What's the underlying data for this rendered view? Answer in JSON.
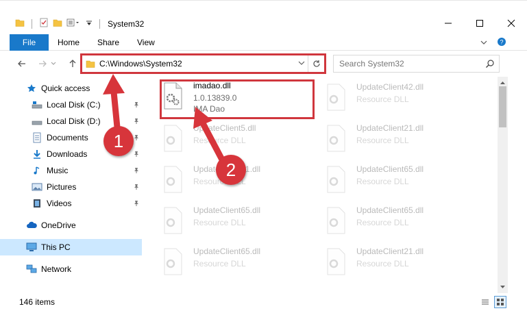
{
  "window": {
    "title": "System32",
    "controls": [
      "minimize-icon",
      "maximize-icon",
      "close-icon"
    ]
  },
  "ribbon": {
    "file_label": "File",
    "tabs": [
      "Home",
      "Share",
      "View"
    ]
  },
  "address_bar": {
    "path": "C:\\Windows\\System32"
  },
  "search": {
    "placeholder": "Search System32"
  },
  "sidebar": {
    "items": [
      {
        "label": "Quick access",
        "icon": "star-icon",
        "pinned": false
      },
      {
        "label": "Local Disk (C:)",
        "icon": "drive-icon",
        "pinned": true
      },
      {
        "label": "Local Disk (D:)",
        "icon": "drive-icon",
        "pinned": true
      },
      {
        "label": "Documents",
        "icon": "documents-icon",
        "pinned": true
      },
      {
        "label": "Downloads",
        "icon": "downloads-icon",
        "pinned": true
      },
      {
        "label": "Music",
        "icon": "music-icon",
        "pinned": true
      },
      {
        "label": "Pictures",
        "icon": "pictures-icon",
        "pinned": true
      },
      {
        "label": "Videos",
        "icon": "videos-icon",
        "pinned": true
      },
      {
        "label": "OneDrive",
        "icon": "onedrive-icon",
        "pinned": false
      },
      {
        "label": "This PC",
        "icon": "pc-icon",
        "pinned": false,
        "selected": true
      },
      {
        "label": "Network",
        "icon": "network-icon",
        "pinned": false
      }
    ]
  },
  "files": {
    "highlighted": {
      "name": "imadao.dll",
      "version": "1.0.13839.0",
      "description": "IMA Dao"
    },
    "left_column": [
      {
        "name": "UpdateClient5.dll",
        "description": "Resource DLL"
      },
      {
        "name": "UpdateClient21.dll",
        "description": "Resource DLL"
      },
      {
        "name": "UpdateClient65.dll",
        "description": "Resource DLL"
      },
      {
        "name": "UpdateClient65.dll",
        "description": "Resource DLL"
      }
    ],
    "right_column": [
      {
        "name": "UpdateClient42.dll",
        "description": "Resource DLL"
      },
      {
        "name": "UpdateClient21.dll",
        "description": "Resource DLL"
      },
      {
        "name": "UpdateClient65.dll",
        "description": "Resource DLL"
      },
      {
        "name": "UpdateClient65.dll",
        "description": "Resource DLL"
      },
      {
        "name": "UpdateClient21.dll",
        "description": "Resource DLL"
      }
    ]
  },
  "status": {
    "item_count": "146 items"
  },
  "callouts": {
    "one": "1",
    "two": "2"
  },
  "colors": {
    "accent": "#1979ca",
    "highlight_red": "#d0363d",
    "callout_red": "#d7353b",
    "selected_bg": "#cce8ff"
  }
}
